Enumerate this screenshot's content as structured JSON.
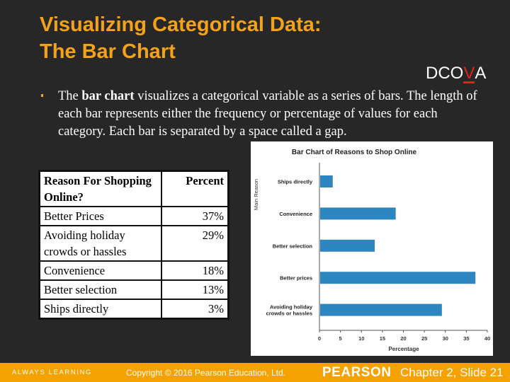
{
  "slide": {
    "title_line1": "Visualizing Categorical Data:",
    "title_line2": "The Bar Chart",
    "dcova": {
      "prefix": "DCO",
      "highlight": "V",
      "suffix": "A",
      "highlight_color": "#d9251c"
    },
    "bullet": {
      "pre": "The ",
      "bold": "bar chart",
      "post": " visualizes a categorical variable as a series of bars. The length of each bar represents either the frequency or percentage of values for each category.  Each bar is separated by a space called a gap."
    }
  },
  "table": {
    "headers": [
      "Reason For Shopping Online?",
      "Percent"
    ],
    "rows": [
      {
        "reason": "Better Prices",
        "percent": "37%"
      },
      {
        "reason": "Avoiding holiday crowds or hassles",
        "percent": "29%"
      },
      {
        "reason": "Convenience",
        "percent": "18%"
      },
      {
        "reason": "Better selection",
        "percent": "13%"
      },
      {
        "reason": "Ships directly",
        "percent": "3%"
      }
    ]
  },
  "chart_data": {
    "type": "bar",
    "orientation": "horizontal",
    "title": "Bar Chart of Reasons to Shop Online",
    "xlabel": "Percentage",
    "ylabel": "Main Reason",
    "categories": [
      "Ships directly",
      "Convenience",
      "Better selection",
      "Better prices",
      "Avoiding holiday crowds or hassles"
    ],
    "category_lines": [
      [
        "Ships directly"
      ],
      [
        "Convenience"
      ],
      [
        "Better selection"
      ],
      [
        "Better prices"
      ],
      [
        "Avoiding holiday",
        "crowds or hassles"
      ]
    ],
    "values": [
      3,
      18,
      13,
      37,
      29
    ],
    "xlim": [
      0,
      40
    ],
    "xticks": [
      0,
      5,
      10,
      15,
      20,
      25,
      30,
      35,
      40
    ],
    "grid": false,
    "legend": "none",
    "bar_color": "#2e86c1"
  },
  "footer": {
    "always_learning": "ALWAYS LEARNING",
    "copyright": "Copyright © 2016 Pearson Education, Ltd.",
    "brand": "PEARSON",
    "chapter": "Chapter 2, Slide 21"
  },
  "colors": {
    "background": "#272727",
    "title": "#f5a21b",
    "footer": "#f5a200"
  }
}
